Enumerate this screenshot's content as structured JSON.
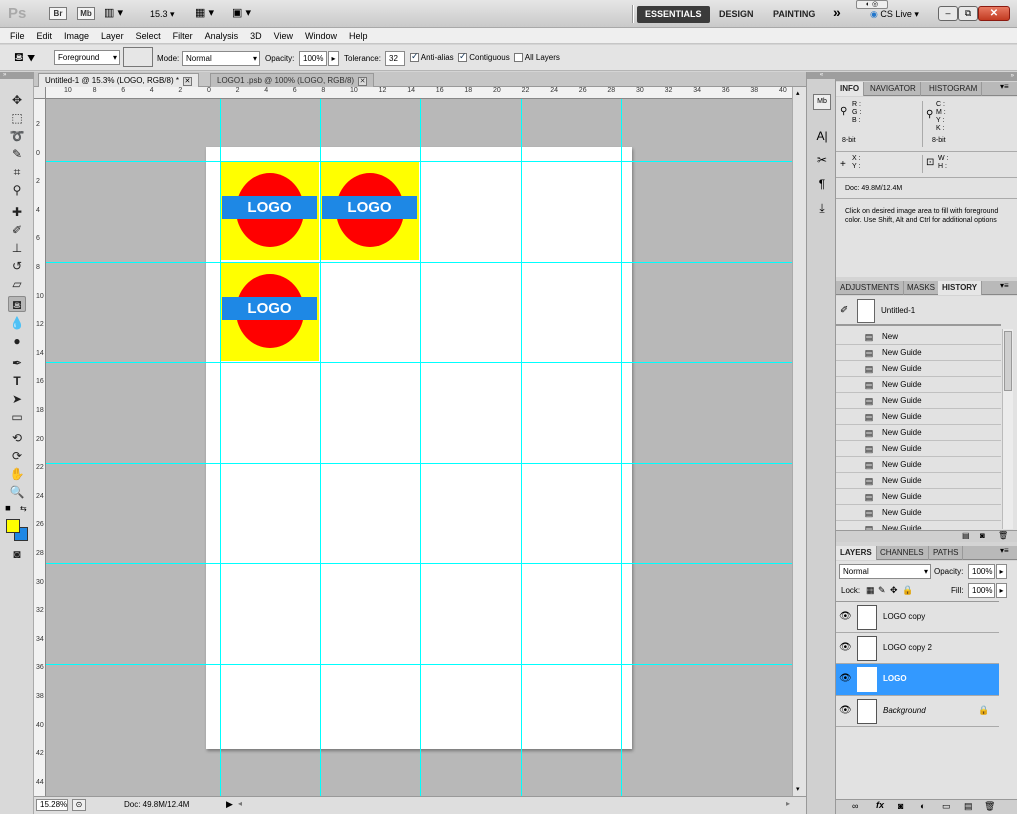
{
  "app_bar": {
    "logo": "Ps",
    "bridge_btn": "Br",
    "minibridge_btn": "Mb",
    "zoom_level": "15.3",
    "workspaces": [
      "ESSENTIALS",
      "DESIGN",
      "PAINTING"
    ],
    "more": "»",
    "cs_live": "CS Live"
  },
  "menu": [
    "File",
    "Edit",
    "Image",
    "Layer",
    "Select",
    "Filter",
    "Analysis",
    "3D",
    "View",
    "Window",
    "Help"
  ],
  "options": {
    "fill_source": "Foreground",
    "mode_label": "Mode:",
    "mode_value": "Normal",
    "opacity_label": "Opacity:",
    "opacity_value": "100%",
    "tolerance_label": "Tolerance:",
    "tolerance_value": "32",
    "anti_alias": "Anti-alias",
    "contiguous": "Contiguous",
    "all_layers": "All Layers"
  },
  "doc_tabs": [
    {
      "label": "Untitled-1 @ 15.3% (LOGO, RGB/8) *"
    },
    {
      "label": "LOGO1 .psb @ 100% (LOGO, RGB/8)"
    }
  ],
  "ruler_h": [
    "10",
    "8",
    "6",
    "4",
    "2",
    "0",
    "2",
    "4",
    "6",
    "8",
    "10",
    "12",
    "14",
    "16",
    "18",
    "20",
    "22",
    "24",
    "26",
    "28",
    "30",
    "32",
    "34",
    "36",
    "38",
    "40"
  ],
  "ruler_v": [
    "2",
    "0",
    "2",
    "4",
    "6",
    "8",
    "10",
    "12",
    "14",
    "16",
    "18",
    "20",
    "22",
    "24",
    "26",
    "28",
    "30",
    "32",
    "34",
    "36",
    "38",
    "40",
    "42",
    "44"
  ],
  "logo_text": "LOGO",
  "colors": {
    "logo_bg": "#ffff00",
    "logo_circle": "#ff0000",
    "logo_band": "#1e88e5",
    "guide": "#00ffff",
    "selection": "#3399ff",
    "foreground": "#ffff00",
    "background": "#1e88e5"
  },
  "status": {
    "zoom": "15.28%",
    "doc": "Doc: 49.8M/12.4M"
  },
  "info_panel": {
    "tabs": [
      "INFO",
      "NAVIGATOR",
      "HISTOGRAM"
    ],
    "rgb": [
      "R :",
      "G :",
      "B :"
    ],
    "cmyk": [
      "C :",
      "M :",
      "Y :",
      "K :"
    ],
    "bit_left": "8-bit",
    "bit_right": "8-bit",
    "xy": [
      "X :",
      "Y :"
    ],
    "wh": [
      "W :",
      "H :"
    ],
    "doc": "Doc: 49.8M/12.4M",
    "hint": "Click on desired image area to fill with foreground color. Use Shift, Alt and Ctrl for additional options"
  },
  "history_panel": {
    "tabs": [
      "ADJUSTMENTS",
      "MASKS",
      "HISTORY"
    ],
    "snapshot": "Untitled-1",
    "items": [
      "New",
      "New Guide",
      "New Guide",
      "New Guide",
      "New Guide",
      "New Guide",
      "New Guide",
      "New Guide",
      "New Guide",
      "New Guide",
      "New Guide",
      "New Guide",
      "New Guide"
    ]
  },
  "layers_panel": {
    "tabs": [
      "LAYERS",
      "CHANNELS",
      "PATHS"
    ],
    "blend_mode": "Normal",
    "opacity_label": "Opacity:",
    "opacity_value": "100%",
    "lock_label": "Lock:",
    "fill_label": "Fill:",
    "fill_value": "100%",
    "layers": [
      {
        "name": "LOGO copy",
        "selected": false
      },
      {
        "name": "LOGO copy 2",
        "selected": false
      },
      {
        "name": "LOGO",
        "selected": true
      },
      {
        "name": "Background",
        "selected": false
      }
    ]
  }
}
